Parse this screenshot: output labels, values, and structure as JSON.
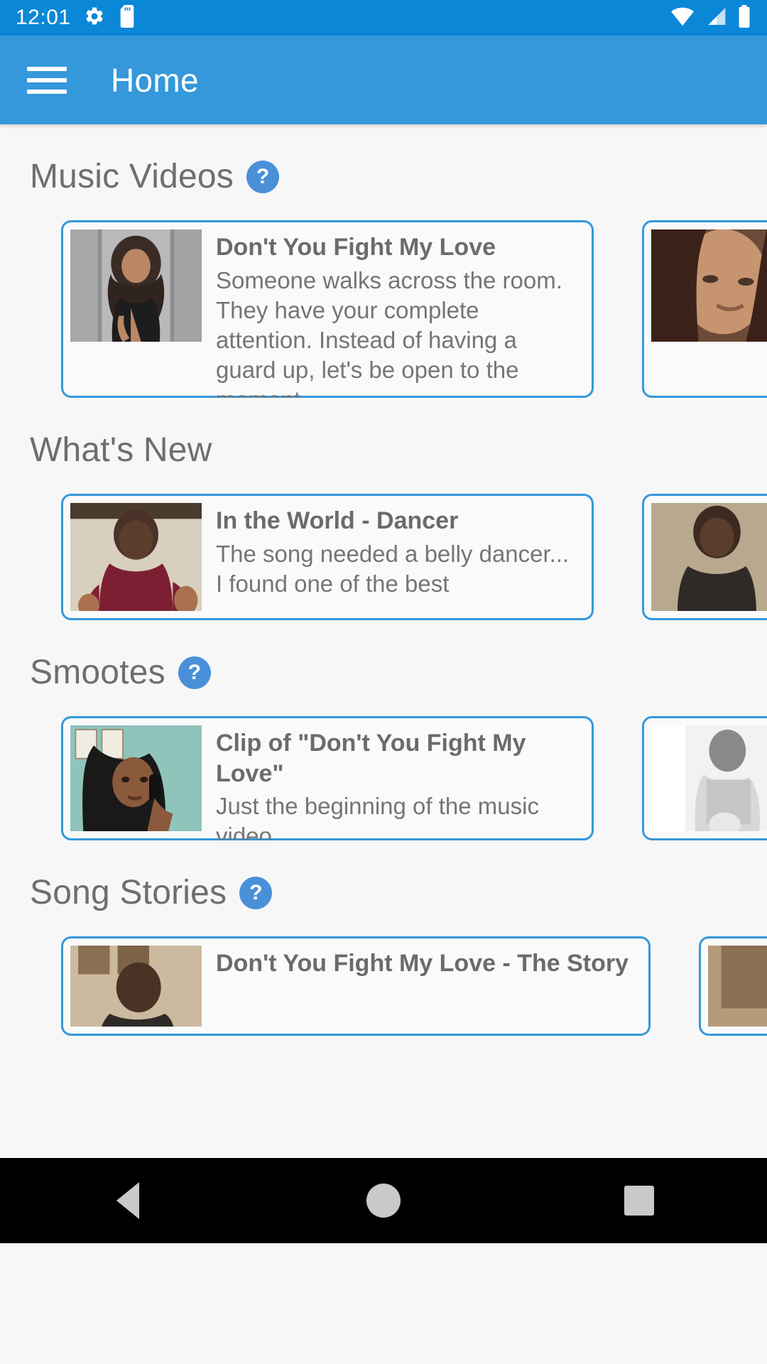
{
  "status_bar": {
    "time": "12:01",
    "icons": [
      "gear-icon",
      "sd-card-icon"
    ],
    "right_icons": [
      "wifi-icon",
      "cell-signal-icon",
      "battery-icon"
    ],
    "background": "#0b87d8"
  },
  "app_bar": {
    "menu_icon": "hamburger-menu-icon",
    "title": "Home",
    "background": "#3498db"
  },
  "colors": {
    "accent": "#3498db",
    "status_bar": "#0b87d8",
    "page_background": "#f7f7f7",
    "card_border": "#3498db",
    "heading_text": "#6e6e6e",
    "body_text": "#757575",
    "help_badge": "#4a90d9"
  },
  "sections": [
    {
      "title": "Music Videos",
      "has_help": true,
      "help_label": "?",
      "cards": [
        {
          "title": "Don't You Fight My Love",
          "description": "Someone walks across the room. They have your complete attention. Instead of having a guard up, let's be open to the moment",
          "thumb": "woman-with-curly-hair-portrait"
        },
        {
          "title": "",
          "description": "",
          "thumb": "woman-looking-down-portrait"
        }
      ]
    },
    {
      "title": "What's New",
      "has_help": false,
      "help_label": "",
      "cards": [
        {
          "title": "In the World - Dancer",
          "description": "The song needed a belly dancer... I found one of the best",
          "thumb": "man-in-maroon-shirt"
        },
        {
          "title": "",
          "description": "",
          "thumb": "man-in-dark-shirt"
        }
      ]
    },
    {
      "title": "Smootes",
      "has_help": true,
      "help_label": "?",
      "cards": [
        {
          "title": "Clip of \"Don't You Fight My Love\"",
          "description": "Just the beginning of the music video",
          "thumb": "woman-on-phone-teal-background"
        },
        {
          "title": "",
          "description": "",
          "thumb": "person-black-and-white-photo"
        }
      ]
    },
    {
      "title": "Song Stories",
      "has_help": true,
      "help_label": "?",
      "cards": [
        {
          "title": "Don't You Fight My Love - The Story",
          "description": "",
          "thumb": "man-speaking-indoors"
        },
        {
          "title": "",
          "description": "",
          "thumb": "indoor-scene-thumbnail"
        }
      ]
    }
  ],
  "nav_bar": {
    "back_label": "back-button",
    "home_label": "home-button",
    "recents_label": "recents-button"
  }
}
